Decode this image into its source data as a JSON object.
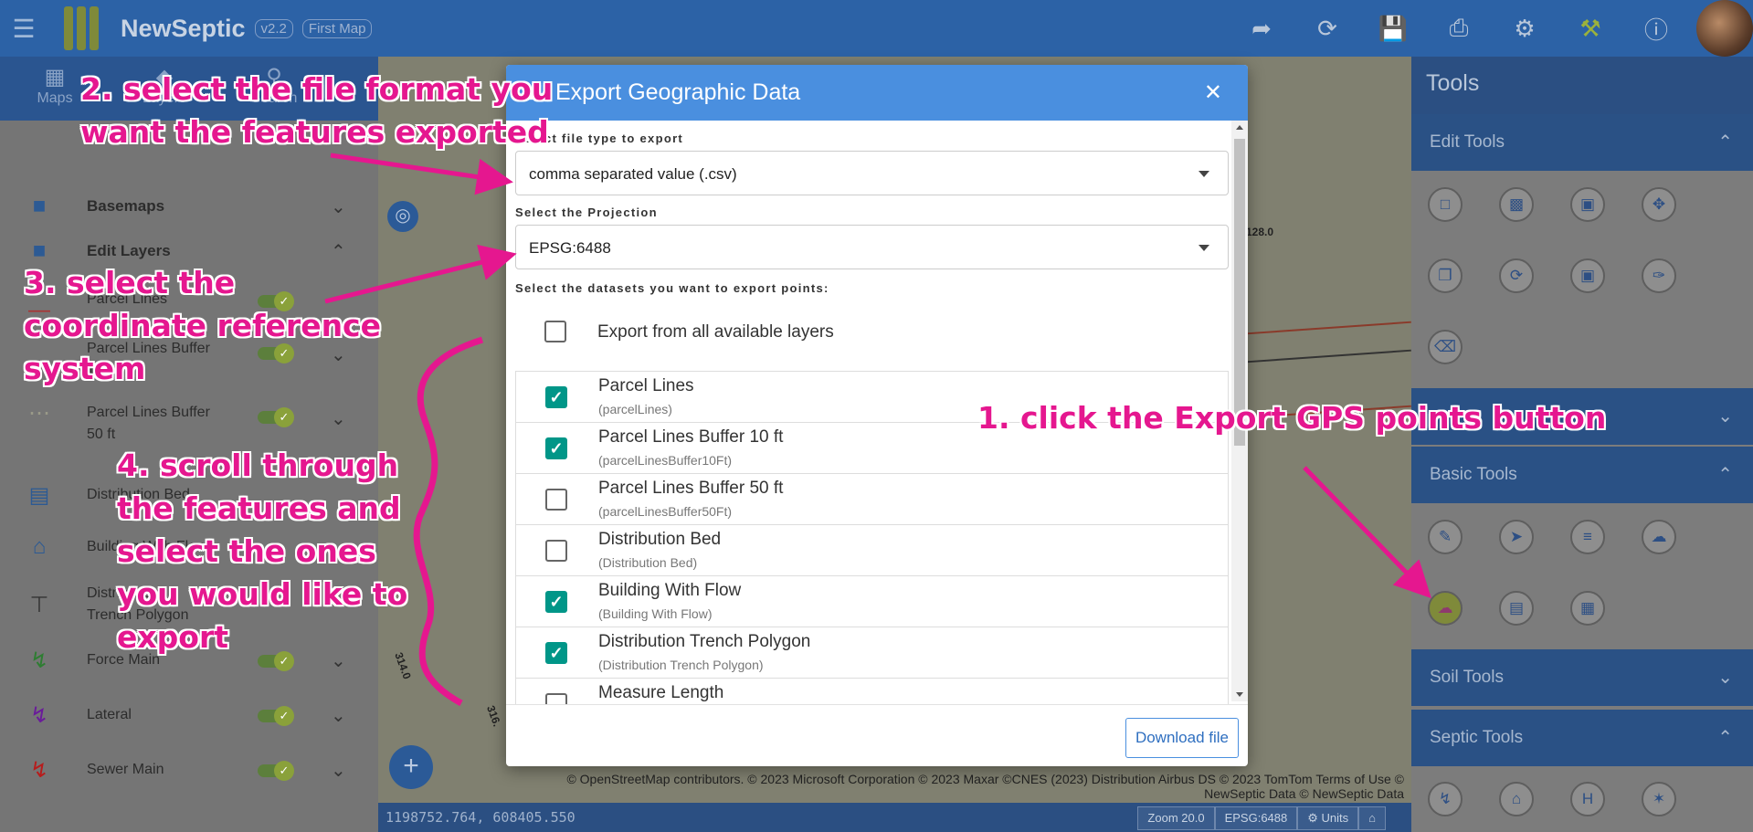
{
  "app": {
    "title": "NewSeptic",
    "version": "v2.2",
    "map_name": "First Map"
  },
  "left_panel": {
    "tabs": [
      {
        "label": "Maps"
      },
      {
        "label": "Layers"
      },
      {
        "label": "Search"
      }
    ],
    "layers": [
      {
        "label": "Basemaps"
      },
      {
        "label": "Edit Layers"
      },
      {
        "label": "Parcel Lines"
      },
      {
        "label": "Parcel Lines Buffer 10 ft"
      },
      {
        "label": "Parcel Lines Buffer 50 ft"
      },
      {
        "label": "Distribution Bed"
      },
      {
        "label": "Building With Flow"
      },
      {
        "label": "Distribution Trench Polygon"
      },
      {
        "label": "Force Main"
      },
      {
        "label": "Lateral"
      },
      {
        "label": "Sewer Main"
      }
    ]
  },
  "dialog": {
    "title": "Export Geographic Data",
    "file_type_label": "Select file type to export",
    "file_type_value": "comma separated value (.csv)",
    "projection_label": "Select the Projection",
    "projection_value": "EPSG:6488",
    "datasets_label": "Select the datasets you want to export points:",
    "export_all_label": "Export from all available layers",
    "datasets": [
      {
        "title": "Parcel Lines",
        "sub": "(parcelLines)",
        "checked": true
      },
      {
        "title": "Parcel Lines Buffer 10 ft",
        "sub": "(parcelLinesBuffer10Ft)",
        "checked": true
      },
      {
        "title": "Parcel Lines Buffer 50 ft",
        "sub": "(parcelLinesBuffer50Ft)",
        "checked": false
      },
      {
        "title": "Distribution Bed",
        "sub": "(Distribution Bed)",
        "checked": false
      },
      {
        "title": "Building With Flow",
        "sub": "(Building With Flow)",
        "checked": true
      },
      {
        "title": "Distribution Trench Polygon",
        "sub": "(Distribution Trench Polygon)",
        "checked": true
      },
      {
        "title": "Measure Length",
        "sub": "",
        "checked": false
      }
    ],
    "download_label": "Download file"
  },
  "right_panel": {
    "title": "Tools",
    "sections": [
      "Edit Tools",
      "Basic Tools",
      "Soil Tools",
      "Septic Tools"
    ]
  },
  "map": {
    "labels": [
      "128.0",
      "314.0",
      "316."
    ],
    "attribution_line1": "© OpenStreetMap contributors. © 2023 Microsoft Corporation © 2023 Maxar ©CNES (2023) Distribution Airbus DS © 2023 TomTom Terms of Use ©",
    "attribution_line2": "NewSeptic Data © NewSeptic Data",
    "coords": "1198752.764, 608405.550",
    "zoom": "Zoom 20.0",
    "epsg": "EPSG:6488",
    "units": "Units"
  },
  "annotations": {
    "step1": "1. click the Export GPS points button",
    "step2": "2. select the file format you want the features exported",
    "step3": "3. select the coordinate reference system",
    "step4": "4. scroll through the features and select the ones you would like to export"
  },
  "colors": {
    "brand": "#2c62a6",
    "dialog_header": "#4a8fdf",
    "checkbox": "#009688",
    "annotation": "#e5178f"
  }
}
